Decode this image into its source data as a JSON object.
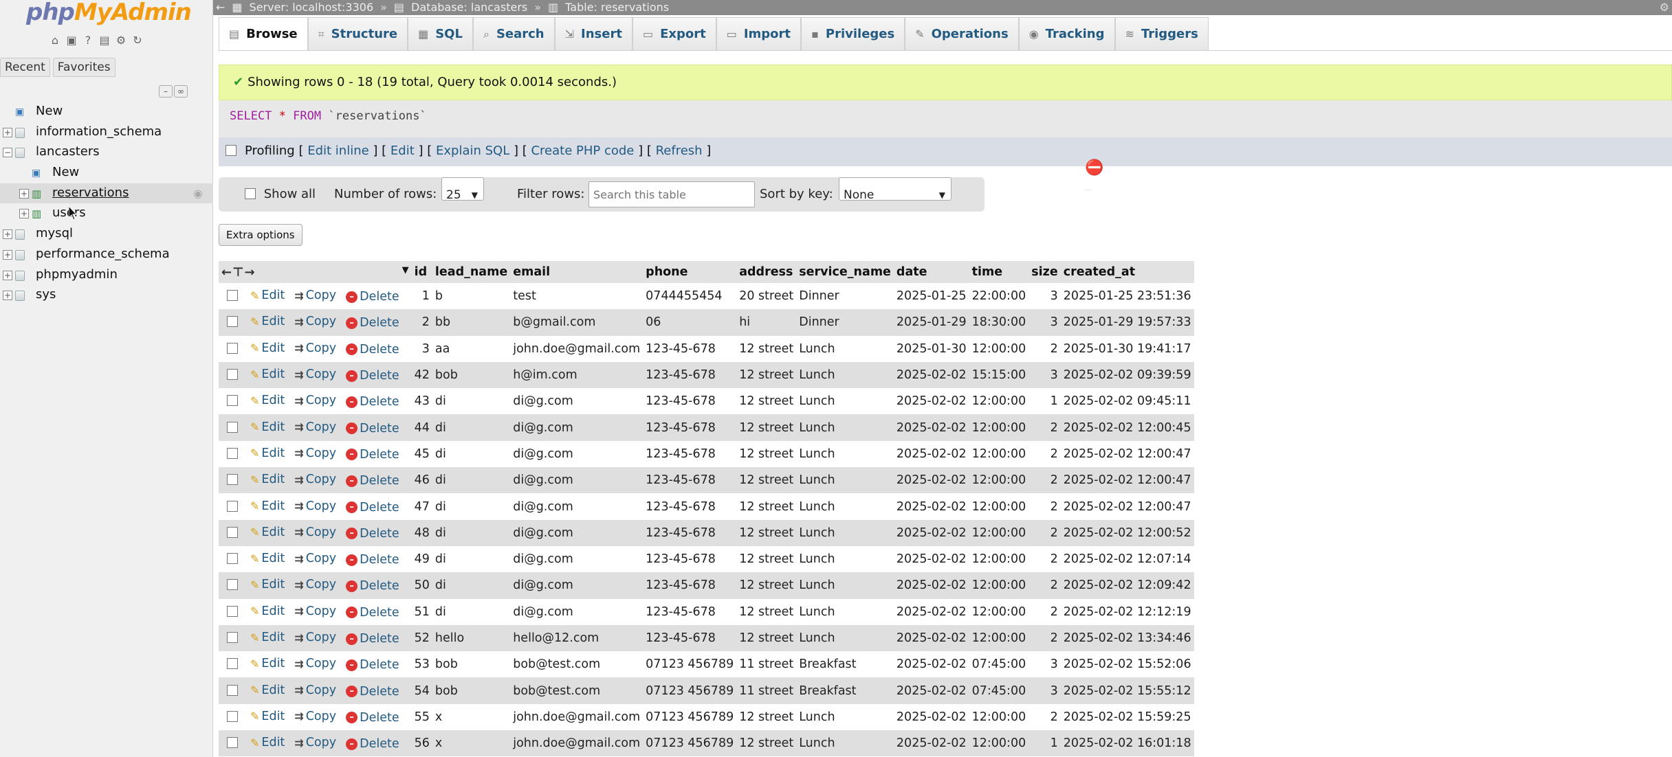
{
  "logo": {
    "part1": "php",
    "part2": "MyAdmin"
  },
  "nav": {
    "recent_tab": "Recent",
    "favorites_tab": "Favorites",
    "tree": [
      {
        "label": "New",
        "level": 0,
        "kind": "new"
      },
      {
        "label": "information_schema",
        "level": 0,
        "kind": "db"
      },
      {
        "label": "lancasters",
        "level": 0,
        "kind": "db",
        "expanded": true
      },
      {
        "label": "New",
        "level": 1,
        "kind": "new"
      },
      {
        "label": "reservations",
        "level": 1,
        "kind": "table",
        "selected": true
      },
      {
        "label": "users",
        "level": 1,
        "kind": "table"
      },
      {
        "label": "mysql",
        "level": 0,
        "kind": "db"
      },
      {
        "label": "performance_schema",
        "level": 0,
        "kind": "db"
      },
      {
        "label": "phpmyadmin",
        "level": 0,
        "kind": "db"
      },
      {
        "label": "sys",
        "level": 0,
        "kind": "db"
      }
    ]
  },
  "breadcrumb": {
    "server": "Server: localhost:3306",
    "database": "Database: lancasters",
    "table": "Table: reservations"
  },
  "tabs": [
    {
      "label": "Browse",
      "icon": "browse-icon",
      "active": true
    },
    {
      "label": "Structure",
      "icon": "structure-icon"
    },
    {
      "label": "SQL",
      "icon": "sql-icon"
    },
    {
      "label": "Search",
      "icon": "search-icon"
    },
    {
      "label": "Insert",
      "icon": "insert-icon"
    },
    {
      "label": "Export",
      "icon": "export-icon"
    },
    {
      "label": "Import",
      "icon": "import-icon"
    },
    {
      "label": "Privileges",
      "icon": "privileges-icon"
    },
    {
      "label": "Operations",
      "icon": "operations-icon"
    },
    {
      "label": "Tracking",
      "icon": "tracking-icon"
    },
    {
      "label": "Triggers",
      "icon": "triggers-icon"
    }
  ],
  "message": {
    "success": "Showing rows 0 - 18 (19 total, Query took 0.0014 seconds.)"
  },
  "sql": {
    "select": "SELECT",
    "star": "*",
    "from": "FROM",
    "table": "`reservations`"
  },
  "profiling": {
    "label": "Profiling",
    "links": [
      "Edit inline",
      "Edit",
      "Explain SQL",
      "Create PHP code",
      "Refresh"
    ]
  },
  "controls": {
    "show_all": "Show all",
    "number_of_rows_label": "Number of rows:",
    "number_of_rows_value": "25",
    "filter_rows_label": "Filter rows:",
    "filter_placeholder": "Search this table",
    "sort_by_key_label": "Sort by key:",
    "sort_by_key_value": "None"
  },
  "extra_options": "Extra options",
  "table": {
    "columns": [
      "id",
      "lead_name",
      "email",
      "phone",
      "address",
      "service_name",
      "date",
      "time",
      "size",
      "created_at"
    ],
    "actions": {
      "edit": "Edit",
      "copy": "Copy",
      "delete": "Delete"
    },
    "rows": [
      [
        "1",
        "b",
        "test",
        "0744455454",
        "20 street",
        "Dinner",
        "2025-01-25",
        "22:00:00",
        "3",
        "2025-01-25 23:51:36"
      ],
      [
        "2",
        "bb",
        "b@gmail.com",
        "06",
        "hi",
        "Dinner",
        "2025-01-29",
        "18:30:00",
        "3",
        "2025-01-29 19:57:33"
      ],
      [
        "3",
        "aa",
        "john.doe@gmail.com",
        "123-45-678",
        "12 street",
        "Lunch",
        "2025-01-30",
        "12:00:00",
        "2",
        "2025-01-30 19:41:17"
      ],
      [
        "42",
        "bob",
        "h@im.com",
        "123-45-678",
        "12 street",
        "Lunch",
        "2025-02-02",
        "15:15:00",
        "3",
        "2025-02-02 09:39:59"
      ],
      [
        "43",
        "di",
        "di@g.com",
        "123-45-678",
        "12 street",
        "Lunch",
        "2025-02-02",
        "12:00:00",
        "1",
        "2025-02-02 09:45:11"
      ],
      [
        "44",
        "di",
        "di@g.com",
        "123-45-678",
        "12 street",
        "Lunch",
        "2025-02-02",
        "12:00:00",
        "2",
        "2025-02-02 12:00:45"
      ],
      [
        "45",
        "di",
        "di@g.com",
        "123-45-678",
        "12 street",
        "Lunch",
        "2025-02-02",
        "12:00:00",
        "2",
        "2025-02-02 12:00:47"
      ],
      [
        "46",
        "di",
        "di@g.com",
        "123-45-678",
        "12 street",
        "Lunch",
        "2025-02-02",
        "12:00:00",
        "2",
        "2025-02-02 12:00:47"
      ],
      [
        "47",
        "di",
        "di@g.com",
        "123-45-678",
        "12 street",
        "Lunch",
        "2025-02-02",
        "12:00:00",
        "2",
        "2025-02-02 12:00:47"
      ],
      [
        "48",
        "di",
        "di@g.com",
        "123-45-678",
        "12 street",
        "Lunch",
        "2025-02-02",
        "12:00:00",
        "2",
        "2025-02-02 12:00:52"
      ],
      [
        "49",
        "di",
        "di@g.com",
        "123-45-678",
        "12 street",
        "Lunch",
        "2025-02-02",
        "12:00:00",
        "2",
        "2025-02-02 12:07:14"
      ],
      [
        "50",
        "di",
        "di@g.com",
        "123-45-678",
        "12 street",
        "Lunch",
        "2025-02-02",
        "12:00:00",
        "2",
        "2025-02-02 12:09:42"
      ],
      [
        "51",
        "di",
        "di@g.com",
        "123-45-678",
        "12 street",
        "Lunch",
        "2025-02-02",
        "12:00:00",
        "2",
        "2025-02-02 12:12:19"
      ],
      [
        "52",
        "hello",
        "hello@12.com",
        "123-45-678",
        "12 street",
        "Lunch",
        "2025-02-02",
        "12:00:00",
        "2",
        "2025-02-02 13:34:46"
      ],
      [
        "53",
        "bob",
        "bob@test.com",
        "07123 456789",
        "11 street",
        "Breakfast",
        "2025-02-02",
        "07:45:00",
        "3",
        "2025-02-02 15:52:06"
      ],
      [
        "54",
        "bob",
        "bob@test.com",
        "07123 456789",
        "11 street",
        "Breakfast",
        "2025-02-02",
        "07:45:00",
        "3",
        "2025-02-02 15:55:12"
      ],
      [
        "55",
        "x",
        "john.doe@gmail.com",
        "07123 456789",
        "12 street",
        "Lunch",
        "2025-02-02",
        "12:00:00",
        "2",
        "2025-02-02 15:59:25"
      ],
      [
        "56",
        "x",
        "john.doe@gmail.com",
        "07123 456789",
        "12 street",
        "Lunch",
        "2025-02-02",
        "12:00:00",
        "1",
        "2025-02-02 16:01:18"
      ]
    ]
  }
}
